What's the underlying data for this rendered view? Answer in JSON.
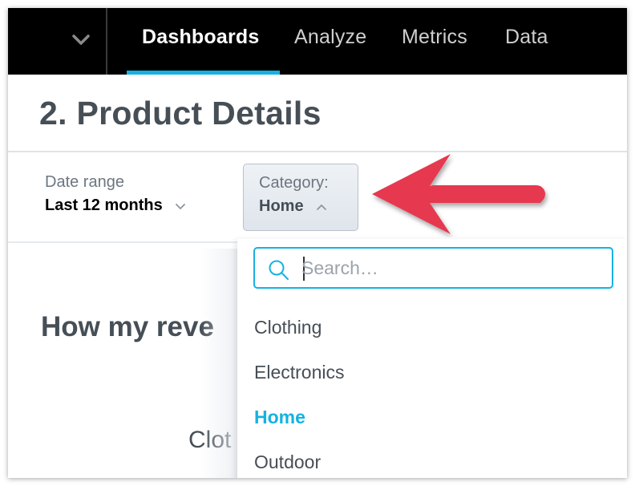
{
  "nav": {
    "items": [
      {
        "label": "Dashboards",
        "active": true
      },
      {
        "label": "Analyze",
        "active": false
      },
      {
        "label": "Metrics",
        "active": false
      },
      {
        "label": "Data",
        "active": false
      }
    ],
    "accent_color": "#14b2e2"
  },
  "page": {
    "title": "2. Product Details"
  },
  "filters": {
    "date_range": {
      "label": "Date range",
      "value": "Last 12 months"
    },
    "category": {
      "label": "Category:",
      "value": "Home",
      "open": true
    }
  },
  "widget": {
    "title": "How my reve",
    "axis_label": "Clot"
  },
  "dropdown": {
    "search_placeholder": "Search…",
    "search_value": "",
    "options": [
      {
        "label": "Clothing",
        "selected": false
      },
      {
        "label": "Electronics",
        "selected": false
      },
      {
        "label": "Home",
        "selected": true
      },
      {
        "label": "Outdoor",
        "selected": false
      }
    ]
  },
  "annotation": {
    "type": "arrow",
    "color": "#e63950",
    "points_to": "category-filter"
  }
}
